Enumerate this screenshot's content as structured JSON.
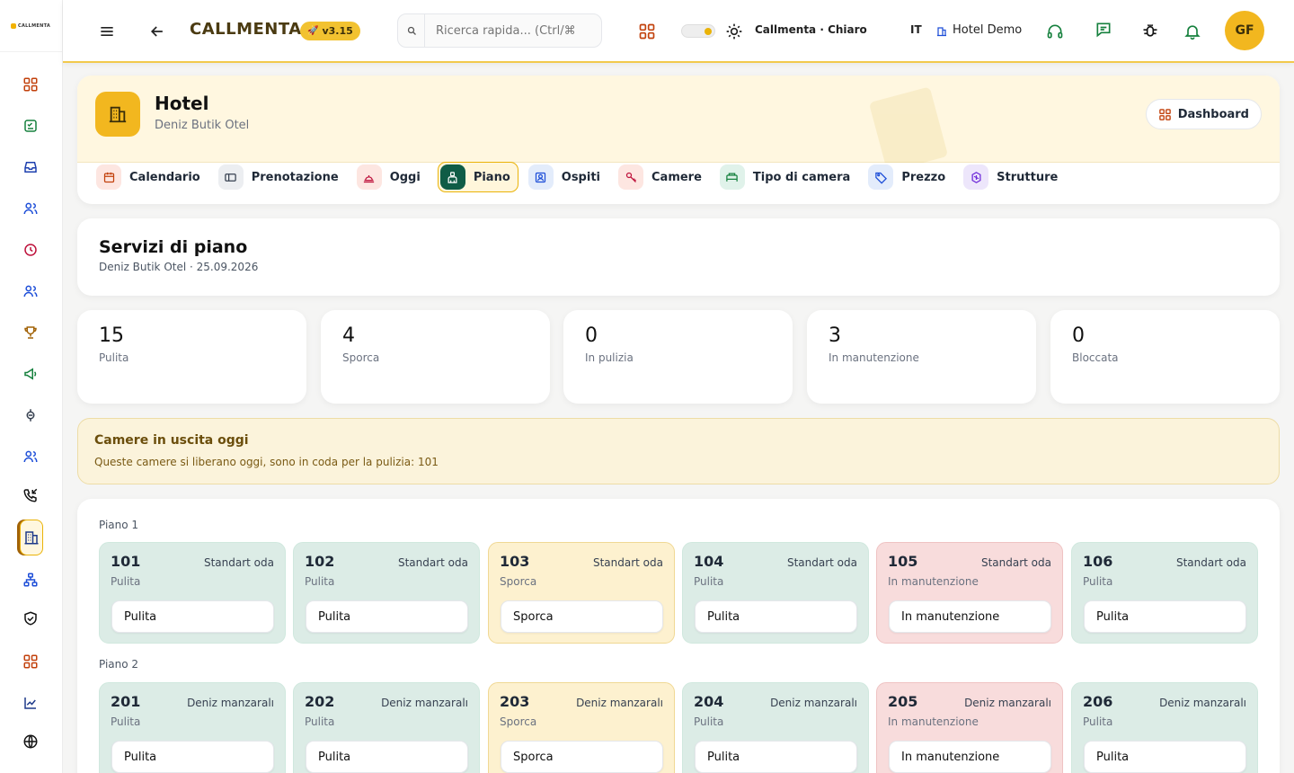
{
  "app": {
    "logo_text": "CALLMENTA",
    "brand": "CALLMENTA",
    "version": "v3.15",
    "search_placeholder": "Ricerca rapida... (Ctrl/⌘",
    "theme_label": "Callmenta · Chiaro",
    "language": "IT",
    "hotel_name": "Hotel Demo",
    "avatar_initials": "GF",
    "accent_color": "#f2b71f"
  },
  "sidebar": {
    "items": [
      {
        "icon": "dashboard-icon"
      },
      {
        "icon": "checklist-icon"
      },
      {
        "icon": "inbox-icon"
      },
      {
        "icon": "users-icon"
      },
      {
        "icon": "clock-icon"
      },
      {
        "icon": "team-icon"
      },
      {
        "icon": "trophy-icon"
      },
      {
        "icon": "megaphone-icon"
      },
      {
        "icon": "integration-icon"
      },
      {
        "icon": "contacts-icon"
      },
      {
        "icon": "call-in-icon"
      },
      {
        "icon": "hotel-icon",
        "active": true
      },
      {
        "icon": "hierarchy-icon"
      },
      {
        "icon": "shield-icon"
      },
      {
        "icon": "apps-icon"
      },
      {
        "icon": "chart-icon"
      },
      {
        "icon": "globe-icon"
      }
    ]
  },
  "header": {
    "title": "Hotel",
    "subtitle": "Deniz Butik Otel",
    "dashboard_button": "Dashboard",
    "tabs": [
      {
        "label": "Calendario",
        "icon": "calendar-icon",
        "color": "#fde6e1"
      },
      {
        "label": "Prenotazione",
        "icon": "booking-icon",
        "color": "#eceef1"
      },
      {
        "label": "Oggi",
        "icon": "bell-service-icon",
        "color": "#fde6e1"
      },
      {
        "label": "Piano",
        "icon": "cleaning-icon",
        "color": "#0f5c46",
        "active": true
      },
      {
        "label": "Ospiti",
        "icon": "guest-icon",
        "color": "#e3ecfb"
      },
      {
        "label": "Camere",
        "icon": "key-icon",
        "color": "#fde6e1"
      },
      {
        "label": "Tipo di camera",
        "icon": "bed-icon",
        "color": "#e0f2ea"
      },
      {
        "label": "Prezzo",
        "icon": "tag-icon",
        "color": "#e3ecfb"
      },
      {
        "label": "Strutture",
        "icon": "building-icon",
        "color": "#ede6fb"
      }
    ]
  },
  "page": {
    "title": "Servizi di piano",
    "subtitle": "Deniz Butik Otel · 25.09.2026"
  },
  "stats": [
    {
      "value": "15",
      "label": "Pulita"
    },
    {
      "value": "4",
      "label": "Sporca"
    },
    {
      "value": "0",
      "label": "In pulizia"
    },
    {
      "value": "3",
      "label": "In manutenzione"
    },
    {
      "value": "0",
      "label": "Bloccata"
    }
  ],
  "alert": {
    "title": "Camere in uscita oggi",
    "body": "Queste camere si liberano oggi, sono in coda per la pulizia: 101"
  },
  "floors": [
    {
      "label": "Piano 1",
      "rooms": [
        {
          "number": "101",
          "type": "Standart oda",
          "status": "Pulita",
          "select": "Pulita",
          "kind": "clean"
        },
        {
          "number": "102",
          "type": "Standart oda",
          "status": "Pulita",
          "select": "Pulita",
          "kind": "clean"
        },
        {
          "number": "103",
          "type": "Standart oda",
          "status": "Sporca",
          "select": "Sporca",
          "kind": "dirty"
        },
        {
          "number": "104",
          "type": "Standart oda",
          "status": "Pulita",
          "select": "Pulita",
          "kind": "clean"
        },
        {
          "number": "105",
          "type": "Standart oda",
          "status": "In manutenzione",
          "select": "In manutenzione",
          "kind": "maint"
        },
        {
          "number": "106",
          "type": "Standart oda",
          "status": "Pulita",
          "select": "Pulita",
          "kind": "clean"
        }
      ]
    },
    {
      "label": "Piano 2",
      "rooms": [
        {
          "number": "201",
          "type": "Deniz manzaralı",
          "status": "Pulita",
          "select": "Pulita",
          "kind": "clean"
        },
        {
          "number": "202",
          "type": "Deniz manzaralı",
          "status": "Pulita",
          "select": "Pulita",
          "kind": "clean"
        },
        {
          "number": "203",
          "type": "Deniz manzaralı",
          "status": "Sporca",
          "select": "Sporca",
          "kind": "dirty"
        },
        {
          "number": "204",
          "type": "Deniz manzaralı",
          "status": "Pulita",
          "select": "Pulita",
          "kind": "clean"
        },
        {
          "number": "205",
          "type": "Deniz manzaralı",
          "status": "In manutenzione",
          "select": "In manutenzione",
          "kind": "maint"
        },
        {
          "number": "206",
          "type": "Deniz manzaralı",
          "status": "Pulita",
          "select": "Pulita",
          "kind": "clean"
        }
      ]
    }
  ]
}
